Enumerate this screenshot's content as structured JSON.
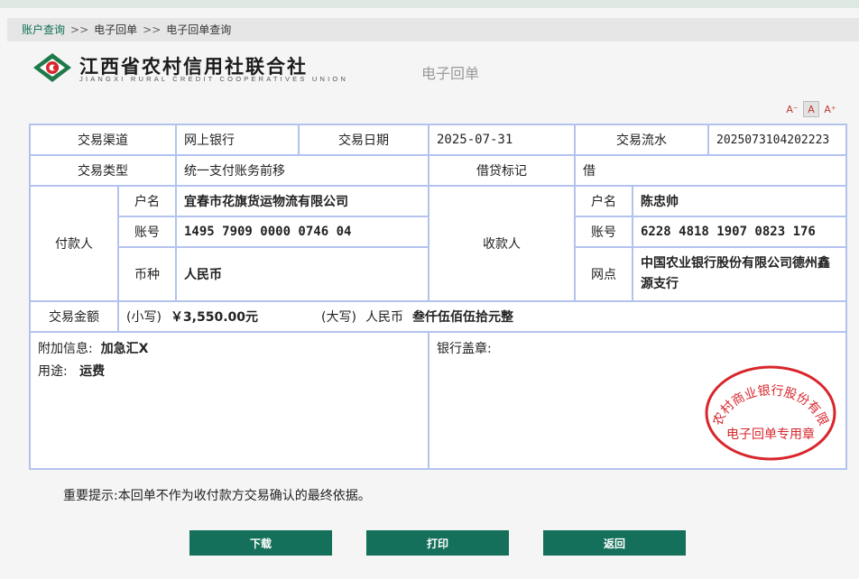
{
  "breadcrumb": {
    "items": [
      "账户查询",
      "电子回单",
      "电子回单查询"
    ],
    "separator": ">>"
  },
  "logo": {
    "name_cn": "江西省农村信用社联合社",
    "name_en": "JIANGXI RURAL CREDIT COOPERATIVES UNION"
  },
  "doc_title": "电子回单",
  "font_controls": {
    "smaller": "A⁻",
    "normal": "A",
    "larger": "A⁺"
  },
  "receipt": {
    "channel_label": "交易渠道",
    "channel": "网上银行",
    "date_label": "交易日期",
    "date": "2025-07-31",
    "serial_label": "交易流水",
    "serial": "2025073104202223",
    "type_label": "交易类型",
    "type": "统一支付账务前移",
    "dc_label": "借贷标记",
    "dc": "借",
    "payer": {
      "label": "付款人",
      "name_label": "户名",
      "name": "宜春市花旗货运物流有限公司",
      "acct_label": "账号",
      "acct": "1495 7909 0000 0746 04",
      "currency_label": "币种",
      "currency": "人民币"
    },
    "payee": {
      "label": "收款人",
      "name_label": "户名",
      "name": "陈忠帅",
      "acct_label": "账号",
      "acct": "6228 4818 1907 0823 176",
      "branch_label": "网点",
      "branch": "中国农业银行股份有限公司德州鑫源支行"
    },
    "amount": {
      "label": "交易金额",
      "small_label": "(小写)",
      "small": "￥3,550.00元",
      "big_label": "(大写)",
      "big_currency": "人民币",
      "big": "叁仟伍佰伍拾元整"
    },
    "extra_label": "附加信息:",
    "extra": "加急汇X",
    "purpose_label": "用途:",
    "purpose": "运费",
    "seal_label": "银行盖章:"
  },
  "stamp": {
    "outer": "宜春农村商业银行股份有限公司",
    "inner": "电子回单专用章",
    "color": "#d8262c"
  },
  "notice": "重要提示:本回单不作为收付款方交易确认的最终依据。",
  "buttons": {
    "download": "下载",
    "print": "打印",
    "back": "返回"
  },
  "colors": {
    "accent": "#14705a",
    "table_border": "#b3c3ee"
  }
}
